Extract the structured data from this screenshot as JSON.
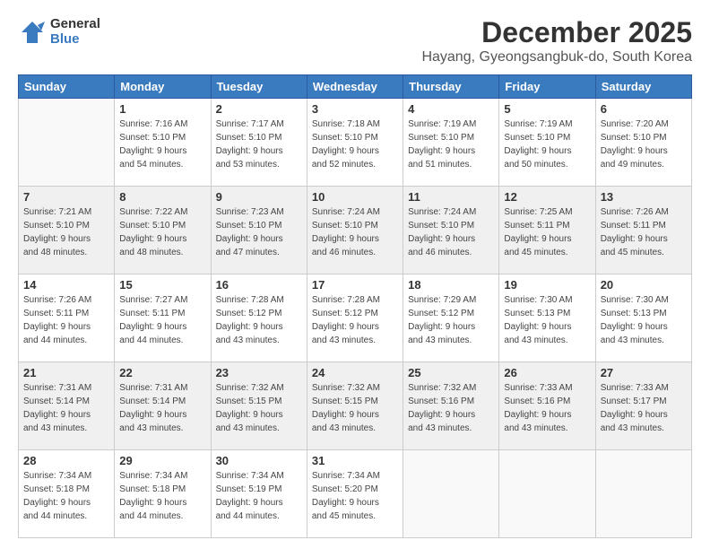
{
  "header": {
    "logo_general": "General",
    "logo_blue": "Blue",
    "month_title": "December 2025",
    "location": "Hayang, Gyeongsangbuk-do, South Korea"
  },
  "days_of_week": [
    "Sunday",
    "Monday",
    "Tuesday",
    "Wednesday",
    "Thursday",
    "Friday",
    "Saturday"
  ],
  "weeks": [
    [
      {
        "day": "",
        "info": ""
      },
      {
        "day": "1",
        "info": "Sunrise: 7:16 AM\nSunset: 5:10 PM\nDaylight: 9 hours\nand 54 minutes."
      },
      {
        "day": "2",
        "info": "Sunrise: 7:17 AM\nSunset: 5:10 PM\nDaylight: 9 hours\nand 53 minutes."
      },
      {
        "day": "3",
        "info": "Sunrise: 7:18 AM\nSunset: 5:10 PM\nDaylight: 9 hours\nand 52 minutes."
      },
      {
        "day": "4",
        "info": "Sunrise: 7:19 AM\nSunset: 5:10 PM\nDaylight: 9 hours\nand 51 minutes."
      },
      {
        "day": "5",
        "info": "Sunrise: 7:19 AM\nSunset: 5:10 PM\nDaylight: 9 hours\nand 50 minutes."
      },
      {
        "day": "6",
        "info": "Sunrise: 7:20 AM\nSunset: 5:10 PM\nDaylight: 9 hours\nand 49 minutes."
      }
    ],
    [
      {
        "day": "7",
        "info": "Sunrise: 7:21 AM\nSunset: 5:10 PM\nDaylight: 9 hours\nand 48 minutes."
      },
      {
        "day": "8",
        "info": "Sunrise: 7:22 AM\nSunset: 5:10 PM\nDaylight: 9 hours\nand 48 minutes."
      },
      {
        "day": "9",
        "info": "Sunrise: 7:23 AM\nSunset: 5:10 PM\nDaylight: 9 hours\nand 47 minutes."
      },
      {
        "day": "10",
        "info": "Sunrise: 7:24 AM\nSunset: 5:10 PM\nDaylight: 9 hours\nand 46 minutes."
      },
      {
        "day": "11",
        "info": "Sunrise: 7:24 AM\nSunset: 5:10 PM\nDaylight: 9 hours\nand 46 minutes."
      },
      {
        "day": "12",
        "info": "Sunrise: 7:25 AM\nSunset: 5:11 PM\nDaylight: 9 hours\nand 45 minutes."
      },
      {
        "day": "13",
        "info": "Sunrise: 7:26 AM\nSunset: 5:11 PM\nDaylight: 9 hours\nand 45 minutes."
      }
    ],
    [
      {
        "day": "14",
        "info": "Sunrise: 7:26 AM\nSunset: 5:11 PM\nDaylight: 9 hours\nand 44 minutes."
      },
      {
        "day": "15",
        "info": "Sunrise: 7:27 AM\nSunset: 5:11 PM\nDaylight: 9 hours\nand 44 minutes."
      },
      {
        "day": "16",
        "info": "Sunrise: 7:28 AM\nSunset: 5:12 PM\nDaylight: 9 hours\nand 43 minutes."
      },
      {
        "day": "17",
        "info": "Sunrise: 7:28 AM\nSunset: 5:12 PM\nDaylight: 9 hours\nand 43 minutes."
      },
      {
        "day": "18",
        "info": "Sunrise: 7:29 AM\nSunset: 5:12 PM\nDaylight: 9 hours\nand 43 minutes."
      },
      {
        "day": "19",
        "info": "Sunrise: 7:30 AM\nSunset: 5:13 PM\nDaylight: 9 hours\nand 43 minutes."
      },
      {
        "day": "20",
        "info": "Sunrise: 7:30 AM\nSunset: 5:13 PM\nDaylight: 9 hours\nand 43 minutes."
      }
    ],
    [
      {
        "day": "21",
        "info": "Sunrise: 7:31 AM\nSunset: 5:14 PM\nDaylight: 9 hours\nand 43 minutes."
      },
      {
        "day": "22",
        "info": "Sunrise: 7:31 AM\nSunset: 5:14 PM\nDaylight: 9 hours\nand 43 minutes."
      },
      {
        "day": "23",
        "info": "Sunrise: 7:32 AM\nSunset: 5:15 PM\nDaylight: 9 hours\nand 43 minutes."
      },
      {
        "day": "24",
        "info": "Sunrise: 7:32 AM\nSunset: 5:15 PM\nDaylight: 9 hours\nand 43 minutes."
      },
      {
        "day": "25",
        "info": "Sunrise: 7:32 AM\nSunset: 5:16 PM\nDaylight: 9 hours\nand 43 minutes."
      },
      {
        "day": "26",
        "info": "Sunrise: 7:33 AM\nSunset: 5:16 PM\nDaylight: 9 hours\nand 43 minutes."
      },
      {
        "day": "27",
        "info": "Sunrise: 7:33 AM\nSunset: 5:17 PM\nDaylight: 9 hours\nand 43 minutes."
      }
    ],
    [
      {
        "day": "28",
        "info": "Sunrise: 7:34 AM\nSunset: 5:18 PM\nDaylight: 9 hours\nand 44 minutes."
      },
      {
        "day": "29",
        "info": "Sunrise: 7:34 AM\nSunset: 5:18 PM\nDaylight: 9 hours\nand 44 minutes."
      },
      {
        "day": "30",
        "info": "Sunrise: 7:34 AM\nSunset: 5:19 PM\nDaylight: 9 hours\nand 44 minutes."
      },
      {
        "day": "31",
        "info": "Sunrise: 7:34 AM\nSunset: 5:20 PM\nDaylight: 9 hours\nand 45 minutes."
      },
      {
        "day": "",
        "info": ""
      },
      {
        "day": "",
        "info": ""
      },
      {
        "day": "",
        "info": ""
      }
    ]
  ]
}
